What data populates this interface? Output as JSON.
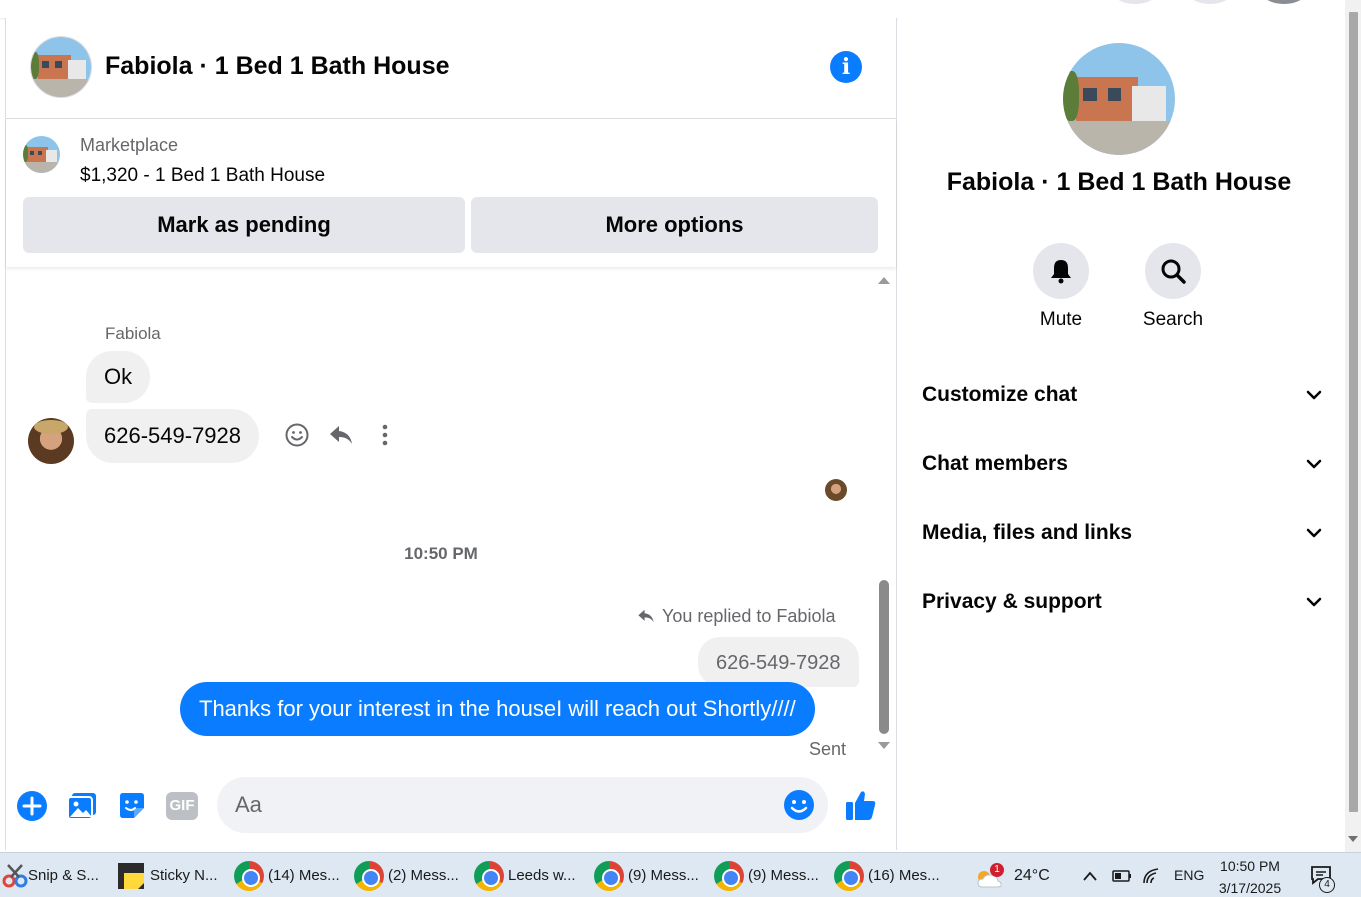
{
  "header": {
    "title": "Fabiola · 1 Bed 1 Bath House",
    "info_icon": "i"
  },
  "marketplace": {
    "label": "Marketplace",
    "listing": "$1,320 - 1 Bed 1 Bath House",
    "mark_pending_label": "Mark as pending",
    "more_options_label": "More options"
  },
  "messages": {
    "sender": "Fabiola",
    "incoming": [
      "Ok",
      "626-549-7928"
    ],
    "timestamp": "10:50 PM",
    "replied_label": "You replied to Fabiola",
    "quoted": "626-549-7928",
    "outgoing": "Thanks for your interest in the houseI will reach out Shortly////",
    "status": "Sent"
  },
  "composer": {
    "placeholder": "Aa",
    "gif_label": "GIF"
  },
  "right_panel": {
    "title": "Fabiola · 1 Bed 1 Bath House",
    "actions": [
      {
        "label": "Mute",
        "icon": "bell-icon"
      },
      {
        "label": "Search",
        "icon": "search-icon"
      }
    ],
    "sections": [
      "Customize chat",
      "Chat members",
      "Media, files and links",
      "Privacy & support"
    ]
  },
  "taskbar": {
    "apps": [
      {
        "label": "Snip & S..."
      },
      {
        "label": "Sticky N..."
      },
      {
        "label": "(14) Mes..."
      },
      {
        "label": "(2) Mess..."
      },
      {
        "label": "Leeds w..."
      },
      {
        "label": "(9) Mess..."
      },
      {
        "label": "(9) Mess..."
      },
      {
        "label": "(16) Mes..."
      }
    ],
    "weather_badge": "1",
    "temperature": "24°C",
    "language": "ENG",
    "time": "10:50 PM",
    "date": "3/17/2025",
    "notification_count": "4"
  },
  "colors": {
    "accent": "#0a7cff",
    "bubble_in": "#f0f0f0",
    "button_bg": "#e4e6eb",
    "taskbar": "#dde8f3"
  }
}
